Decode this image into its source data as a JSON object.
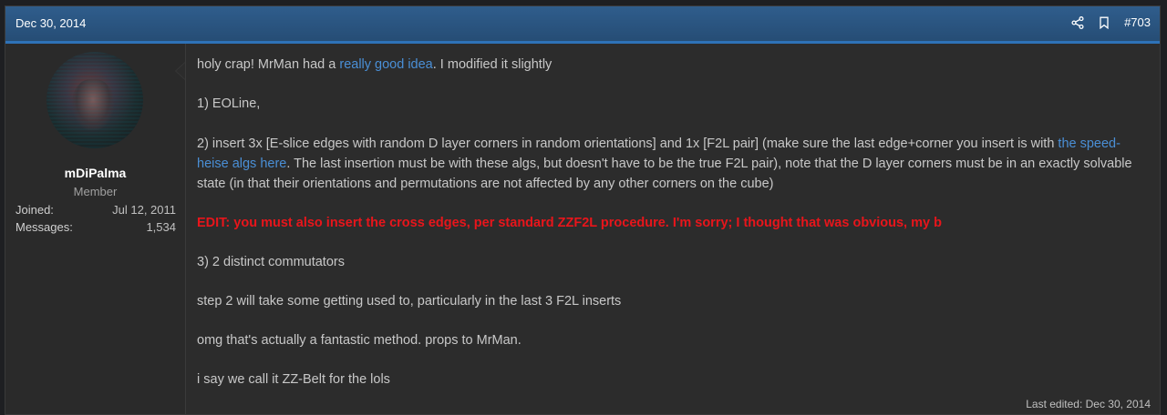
{
  "header": {
    "date": "Dec 30, 2014",
    "post_number": "#703",
    "icons": [
      "share-icon",
      "bookmark-icon"
    ]
  },
  "user": {
    "name": "mDiPalma",
    "title": "Member",
    "stats": [
      {
        "label": "Joined:",
        "value": "Jul 12, 2011"
      },
      {
        "label": "Messages:",
        "value": "1,534"
      }
    ]
  },
  "post": {
    "line1_pre": "holy crap! MrMan had a ",
    "line1_link": "really good idea",
    "line1_post": ". I modified it slightly",
    "line2": "1) EOLine,",
    "line3_pre": "2) insert 3x [E-slice edges with random D layer corners in random orientations] and 1x [F2L pair] (make sure the last edge+corner you insert is with ",
    "line3_link": "the speed-heise algs here",
    "line3_post": ". The last insertion must be with these algs, but doesn't have to be the true F2L pair), note that the D layer corners must be in an exactly solvable state (in that their orientations and permutations are not affected by any other corners on the cube)",
    "edit_line": "EDIT: you must also insert the cross edges, per standard ZZF2L procedure. I'm sorry; I thought that was obvious, my b",
    "line4": "3) 2 distinct commutators",
    "line5": "step 2 will take some getting used to, particularly in the last 3 F2L inserts",
    "line6": "omg that's actually a fantastic method. props to MrMan.",
    "line7": "i say we call it ZZ-Belt for the lols",
    "last_edited": "Last edited: Dec 30, 2014"
  },
  "colors": {
    "header": "#2a5785",
    "accent": "#2e72b8",
    "link": "#4a8fd6",
    "edit": "#e8151b"
  }
}
